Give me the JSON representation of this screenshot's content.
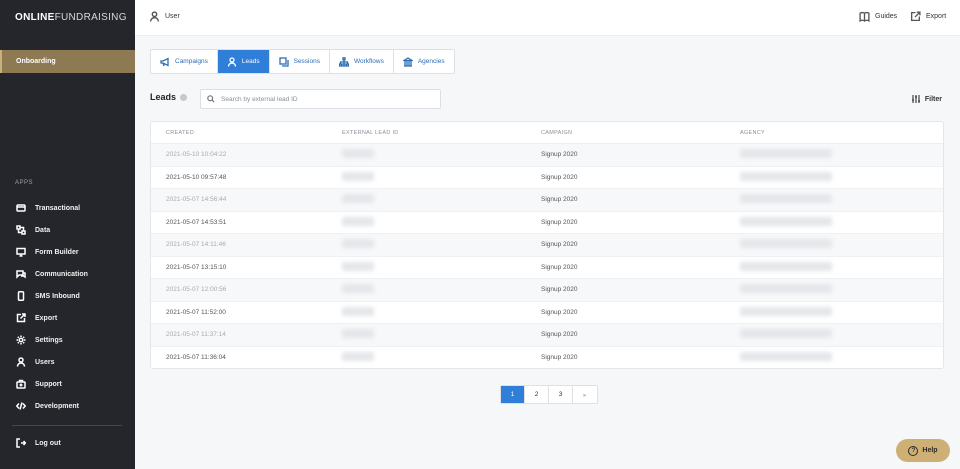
{
  "brand": {
    "bold": "ONLINE",
    "light": "FUNDRAISING"
  },
  "sidebar": {
    "active_item": "Onboarding",
    "apps_label": "APPS",
    "items": [
      {
        "label": "Transactional",
        "icon": "wallet-icon"
      },
      {
        "label": "Data",
        "icon": "data-icon"
      },
      {
        "label": "Form Builder",
        "icon": "monitor-icon"
      },
      {
        "label": "Communication",
        "icon": "chat-icon"
      },
      {
        "label": "SMS Inbound",
        "icon": "phone-icon"
      },
      {
        "label": "Export",
        "icon": "export-icon"
      },
      {
        "label": "Settings",
        "icon": "gear-icon"
      },
      {
        "label": "Users",
        "icon": "user-icon"
      },
      {
        "label": "Support",
        "icon": "support-icon"
      },
      {
        "label": "Development",
        "icon": "code-icon"
      }
    ],
    "logout": "Log out"
  },
  "topbar": {
    "user": "User",
    "guides": "Guides",
    "export": "Export"
  },
  "tabs": [
    {
      "label": "Campaigns",
      "icon": "megaphone-icon"
    },
    {
      "label": "Leads",
      "icon": "user-icon"
    },
    {
      "label": "Sessions",
      "icon": "copy-icon"
    },
    {
      "label": "Workflows",
      "icon": "sitemap-icon"
    },
    {
      "label": "Agencies",
      "icon": "building-icon"
    }
  ],
  "active_tab": "Leads",
  "leads": {
    "title": "Leads",
    "search_placeholder": "Search by external lead ID",
    "filter_label": "Filter"
  },
  "table": {
    "columns": [
      "CREATED",
      "EXTERNAL LEAD ID",
      "CAMPAIGN",
      "AGENCY"
    ],
    "rows": [
      {
        "created": "2021-05-10 10:04:22",
        "campaign": "Signup 2020"
      },
      {
        "created": "2021-05-10 09:57:48",
        "campaign": "Signup 2020"
      },
      {
        "created": "2021-05-07 14:56:44",
        "campaign": "Signup 2020"
      },
      {
        "created": "2021-05-07 14:53:51",
        "campaign": "Signup 2020"
      },
      {
        "created": "2021-05-07 14:11:46",
        "campaign": "Signup 2020"
      },
      {
        "created": "2021-05-07 13:15:10",
        "campaign": "Signup 2020"
      },
      {
        "created": "2021-05-07 12:00:56",
        "campaign": "Signup 2020"
      },
      {
        "created": "2021-05-07 11:52:00",
        "campaign": "Signup 2020"
      },
      {
        "created": "2021-05-07 11:37:14",
        "campaign": "Signup 2020"
      },
      {
        "created": "2021-05-07 11:36:04",
        "campaign": "Signup 2020"
      }
    ]
  },
  "pagination": {
    "pages": [
      "1",
      "2",
      "3"
    ],
    "current": "1",
    "next": "▸"
  },
  "help_label": "Help",
  "colors": {
    "sidebar": "#24262b",
    "active_nav": "#8d7a53",
    "primary": "#2f7ed8",
    "help": "#cfb074"
  }
}
